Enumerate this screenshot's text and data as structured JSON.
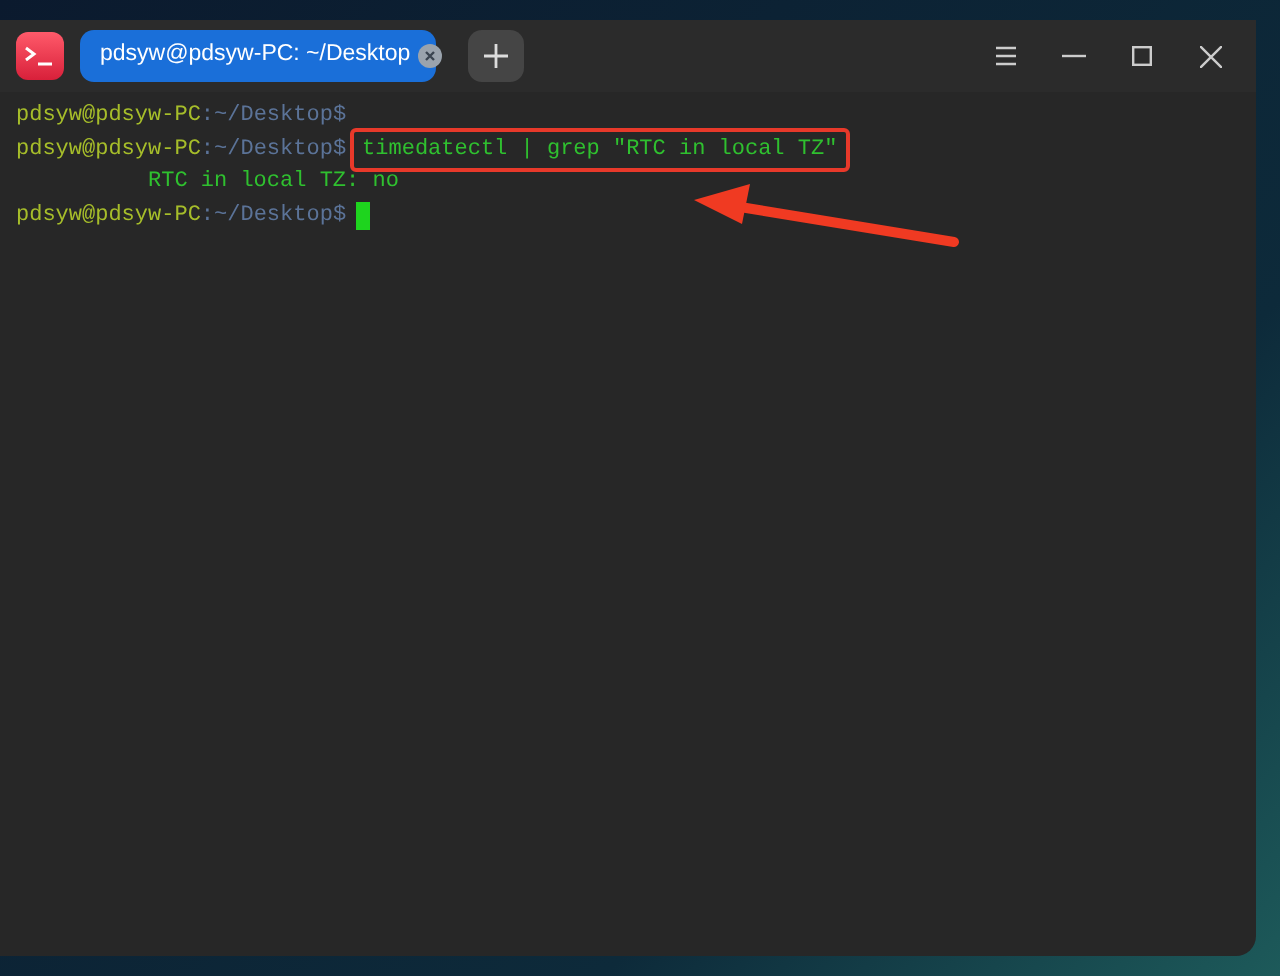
{
  "window": {
    "tab": {
      "title": "pdsyw@pdsyw-PC: ~/Desktop",
      "selected": true
    }
  },
  "terminal": {
    "lines": [
      {
        "kind": "prompt",
        "user": "pdsyw@pdsyw-PC",
        "path": ":~/Desktop",
        "symbol": "$",
        "highlighted": false,
        "cursor": false
      },
      {
        "kind": "prompt",
        "user": "pdsyw@pdsyw-PC",
        "path": ":~/Desktop",
        "symbol": "$",
        "command": "timedatectl | grep \"RTC in local TZ\"",
        "highlighted": true,
        "cursor": false
      },
      {
        "kind": "output",
        "text": "RTC in local TZ: no"
      },
      {
        "kind": "prompt",
        "user": "pdsyw@pdsyw-PC",
        "path": ":~/Desktop",
        "symbol": "$",
        "highlighted": false,
        "cursor": true
      }
    ]
  }
}
